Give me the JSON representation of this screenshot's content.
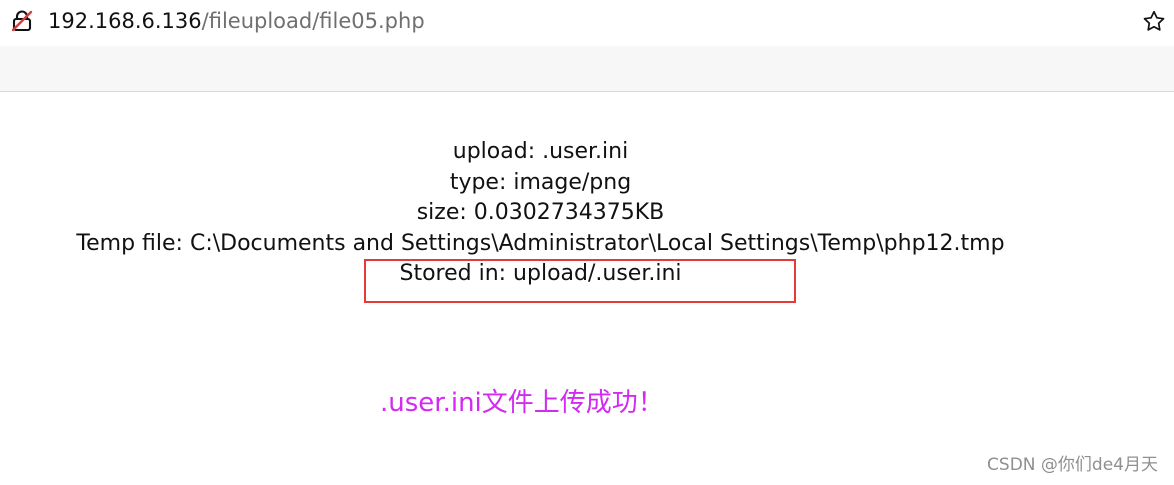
{
  "browser": {
    "url_host": "192.168.6.136",
    "url_path": "/fileupload/file05.php",
    "icons": {
      "security": "insecure-lock-icon",
      "favorite": "star-icon"
    }
  },
  "upload_result": {
    "upload": "upload: .user.ini",
    "type": "type: image/png",
    "size": "size: 0.0302734375KB",
    "temp_file": "Temp file: C:\\Documents and Settings\\Administrator\\Local Settings\\Temp\\php12.tmp",
    "stored_in": "Stored in: upload/.user.ini"
  },
  "annotation": {
    "message": ".user.ini文件上传成功！",
    "highlight_color": "#e33a3a",
    "message_color": "#d32af1"
  },
  "watermark": {
    "text": "CSDN @你们de4月天"
  }
}
